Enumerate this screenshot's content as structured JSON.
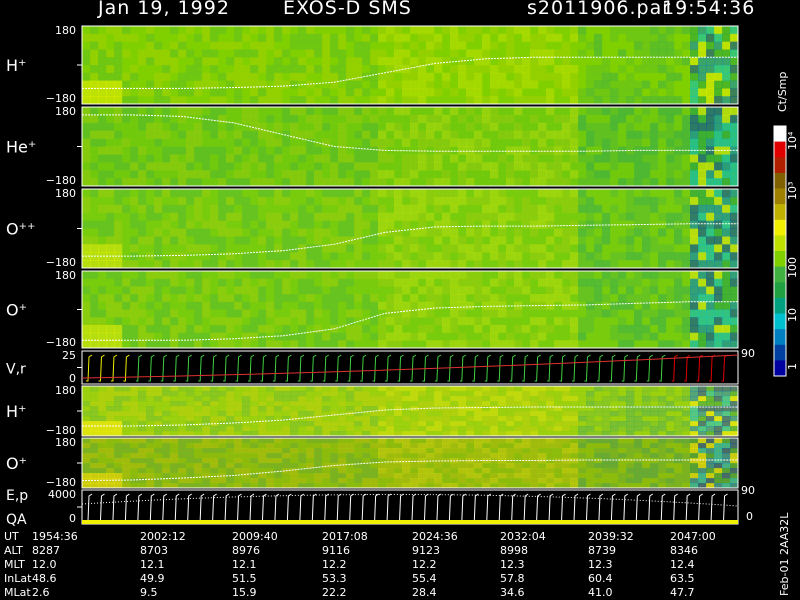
{
  "header": {
    "date": "Jan 19, 1992",
    "instrument": "EXOS-D SMS",
    "file": "s2011906.par",
    "time": "19:54:36"
  },
  "colorbar": {
    "unit": "Ct/Smp",
    "labels": [
      "10⁴",
      "10³",
      "100",
      "10",
      "1"
    ],
    "colors": [
      "#ffffff",
      "#e00000",
      "#b02000",
      "#806000",
      "#a08000",
      "#c0b000",
      "#f0f000",
      "#c0e000",
      "#80d000",
      "#40b040",
      "#20a040",
      "#00a080",
      "#00c0d0",
      "#0080c0",
      "#0040a0",
      "#0000a0"
    ]
  },
  "chart_data": {
    "type": "heatmap",
    "x_label": "UT",
    "panels": [
      {
        "label": "H⁺",
        "ymax": "180",
        "ymin": "−180",
        "base": "#80d000",
        "trace": [
          0.8,
          0.8,
          0.8,
          0.79,
          0.77,
          0.72,
          0.6,
          0.48,
          0.42,
          0.4,
          0.4,
          0.4,
          0.4,
          0.4
        ]
      },
      {
        "label": "He⁺",
        "ymax": "180",
        "ymin": "−180",
        "base": "#60c020",
        "trace": [
          0.1,
          0.1,
          0.12,
          0.2,
          0.35,
          0.5,
          0.55,
          0.56,
          0.56,
          0.56,
          0.56,
          0.55,
          0.55,
          0.55
        ]
      },
      {
        "label": "O⁺⁺",
        "ymax": "180",
        "ymin": "−180",
        "base": "#70c820",
        "trace": [
          0.85,
          0.85,
          0.84,
          0.82,
          0.78,
          0.7,
          0.55,
          0.48,
          0.47,
          0.47,
          0.46,
          0.45,
          0.44,
          0.44
        ]
      },
      {
        "label": "O⁺",
        "ymax": "180",
        "ymin": "−180",
        "base": "#70c820",
        "trace": [
          0.9,
          0.9,
          0.9,
          0.88,
          0.84,
          0.75,
          0.55,
          0.48,
          0.46,
          0.45,
          0.44,
          0.42,
          0.4,
          0.4
        ]
      },
      {
        "label": "V,r",
        "ymax": "25",
        "ymin": "0",
        "right": "90",
        "kind": "vr"
      },
      {
        "label": "H⁺",
        "ymax": "180",
        "ymin": "−180",
        "base": "#c0d020",
        "trace": [
          0.8,
          0.8,
          0.78,
          0.74,
          0.68,
          0.58,
          0.48,
          0.44,
          0.43,
          0.42,
          0.42,
          0.42,
          0.42,
          0.42
        ]
      },
      {
        "label": "O⁺",
        "ymax": "180",
        "ymin": "−180",
        "base": "#a0a020",
        "trace": [
          0.85,
          0.84,
          0.8,
          0.75,
          0.66,
          0.55,
          0.48,
          0.46,
          0.45,
          0.45,
          0.44,
          0.44,
          0.44,
          0.44
        ]
      },
      {
        "label": "E,p",
        "label2": "QA",
        "ymax": "4000",
        "ymin": "0",
        "right": "90",
        "right2": "0",
        "kind": "ep"
      }
    ]
  },
  "table": {
    "rows": [
      {
        "label": "UT",
        "values": [
          "1954:36",
          "2002:12",
          "2009:40",
          "2017:08",
          "2024:36",
          "2032:04",
          "2039:32",
          "2047:00"
        ]
      },
      {
        "label": "ALT",
        "values": [
          "8287",
          "8703",
          "8976",
          "9116",
          "9123",
          "8998",
          "8739",
          "8346"
        ]
      },
      {
        "label": "MLT",
        "values": [
          "12.0",
          "12.1",
          "12.1",
          "12.2",
          "12.2",
          "12.3",
          "12.3",
          "12.4"
        ]
      },
      {
        "label": "InLat",
        "values": [
          "48.6",
          "49.9",
          "51.5",
          "53.3",
          "55.4",
          "57.8",
          "60.4",
          "63.5"
        ]
      },
      {
        "label": "MLat",
        "values": [
          "2.6",
          "9.5",
          "15.9",
          "22.2",
          "28.4",
          "34.6",
          "41.0",
          "47.7"
        ]
      }
    ]
  },
  "footer": {
    "stamp": "Feb-01 2AA32L"
  }
}
